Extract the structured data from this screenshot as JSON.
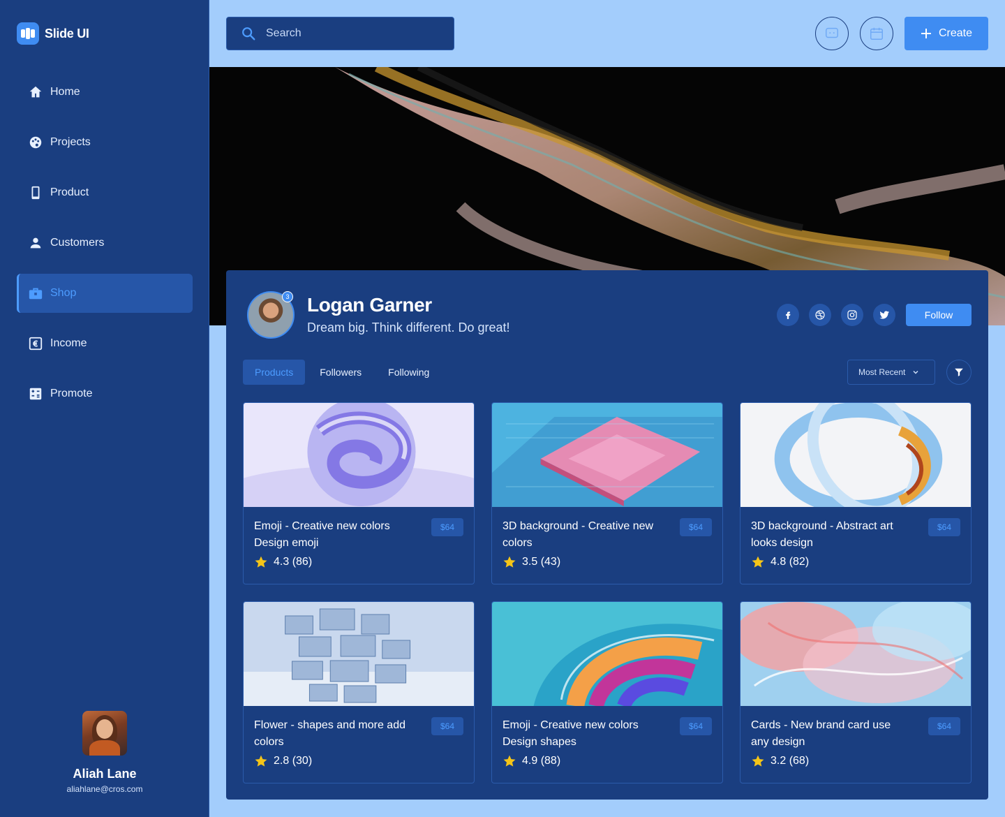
{
  "app": {
    "name": "Slide UI"
  },
  "sidebar": {
    "items": [
      {
        "label": "Home",
        "icon": "home-icon"
      },
      {
        "label": "Projects",
        "icon": "palette-icon"
      },
      {
        "label": "Product",
        "icon": "phone-icon"
      },
      {
        "label": "Customers",
        "icon": "user-icon"
      },
      {
        "label": "Shop",
        "icon": "briefcase-icon",
        "active": true
      },
      {
        "label": "Income",
        "icon": "euro-icon"
      },
      {
        "label": "Promote",
        "icon": "calculator-icon"
      }
    ],
    "user": {
      "name": "Aliah Lane",
      "email": "aliahlane@cros.com"
    }
  },
  "topbar": {
    "search_placeholder": "Search",
    "create_label": "Create"
  },
  "profile": {
    "name": "Logan Garner",
    "tagline": "Dream big. Think different. Do great!",
    "notification_count": "3",
    "follow_label": "Follow",
    "socials": [
      "facebook-icon",
      "dribbble-icon",
      "instagram-icon",
      "twitter-icon"
    ],
    "tabs": [
      {
        "label": "Products",
        "active": true
      },
      {
        "label": "Followers"
      },
      {
        "label": "Following"
      }
    ],
    "sort_label": "Most Recent"
  },
  "products": [
    {
      "title": "Emoji - Creative new colors Design emoji",
      "price": "$64",
      "rating": "4.3 (86)"
    },
    {
      "title": "3D background - Creative new colors",
      "price": "$64",
      "rating": "3.5 (43)"
    },
    {
      "title": "3D background - Abstract art looks design",
      "price": "$64",
      "rating": "4.8 (82)"
    },
    {
      "title": "Flower - shapes and more add colors",
      "price": "$64",
      "rating": "2.8 (30)"
    },
    {
      "title": "Emoji - Creative new colors Design shapes",
      "price": "$64",
      "rating": "4.9 (88)"
    },
    {
      "title": "Cards - New brand card use any design",
      "price": "$64",
      "rating": "3.2 (68)"
    }
  ],
  "colors": {
    "sidebar_bg": "#1a3e80",
    "page_bg": "#a3cdfc",
    "accent": "#3f8cf2",
    "star": "#f5c518"
  }
}
